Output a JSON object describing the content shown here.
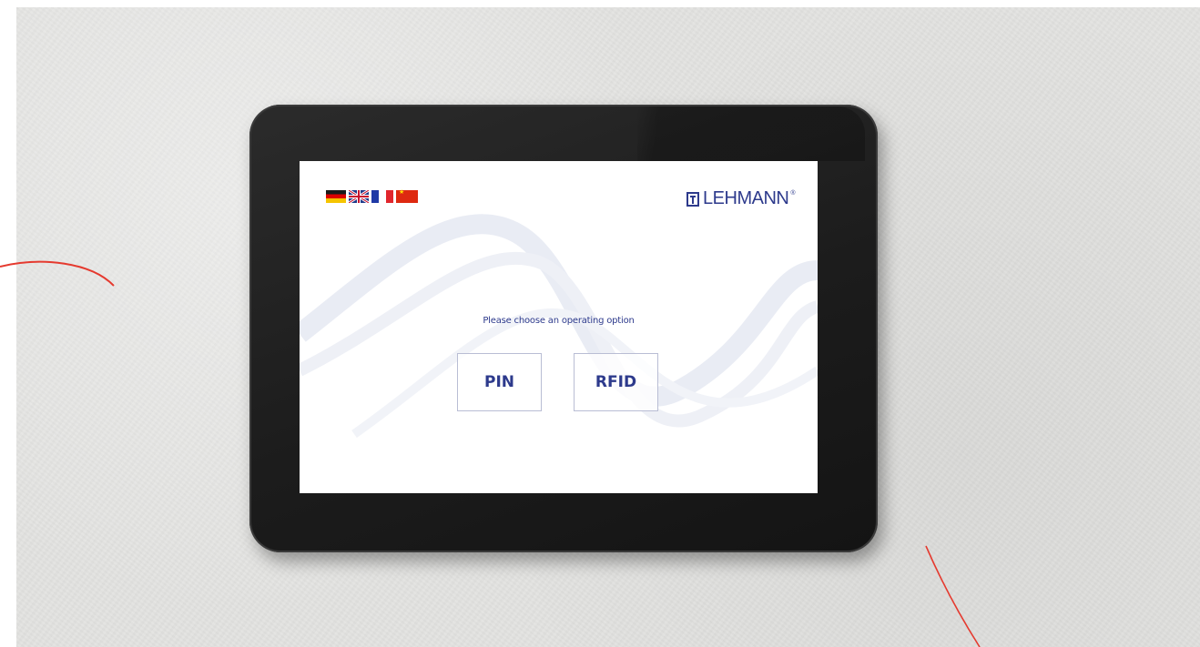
{
  "screen": {
    "language_flags": [
      {
        "icon": "german-flag-icon"
      },
      {
        "icon": "uk-flag-icon"
      },
      {
        "icon": "french-flag-icon"
      },
      {
        "icon": "chinese-flag-icon"
      }
    ],
    "logo": {
      "text": "LEHMANN",
      "registered": "®",
      "icon": "lehmann-logo-icon"
    },
    "prompt": "Please choose an operating option",
    "options": [
      {
        "label": "PIN"
      },
      {
        "label": "RFID"
      }
    ]
  },
  "colors": {
    "brand": "#2d3a8c",
    "annotation": "#e53a2f",
    "bezel": "#1c1c1c",
    "wall": "#e3e3e1"
  }
}
